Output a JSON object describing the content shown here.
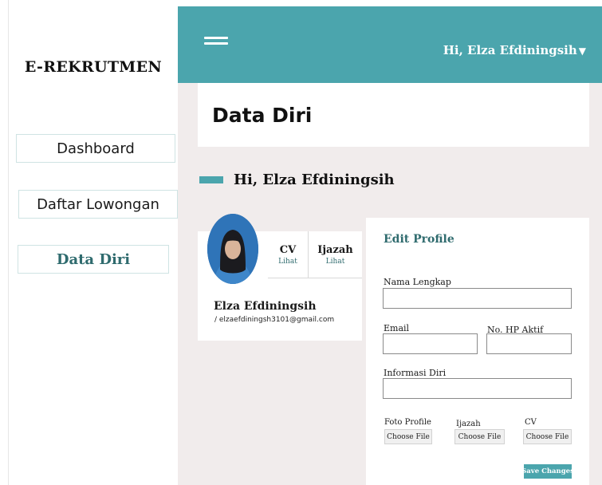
{
  "sidebar": {
    "brand": "E-REKRUTMEN",
    "items": [
      {
        "label": "Dashboard"
      },
      {
        "label": "Daftar Lowongan"
      },
      {
        "label": "Data Diri"
      }
    ]
  },
  "header": {
    "greeting": "Hi, Elza Efdiningsih",
    "caret": "▼"
  },
  "page": {
    "title": "Data Diri",
    "greeting": "Hi, Elza Efdiningsih"
  },
  "profile": {
    "name": "Elza Efdiningsih",
    "email": "/ elzaefdiningsh3101@gmail.com",
    "documents": [
      {
        "name": "CV",
        "link": "Lihat"
      },
      {
        "name": "Ijazah",
        "link": "Lihat"
      }
    ]
  },
  "edit_profile": {
    "title": "Edit Profile",
    "fields": {
      "nama_label": "Nama Lengkap",
      "email_label": "Email",
      "hp_label": "No. HP Aktif",
      "info_label": "Informasi Diri"
    },
    "uploads": [
      {
        "label": "Foto Profile",
        "button": "Choose File"
      },
      {
        "label": "Ijazah",
        "button": "Choose File"
      },
      {
        "label": "CV",
        "button": "Choose File"
      }
    ],
    "save_label": "Save Changes"
  },
  "colors": {
    "accent": "#4ba5ad",
    "accent_dark": "#2f6b6e",
    "main_bg": "#f1ecec"
  }
}
